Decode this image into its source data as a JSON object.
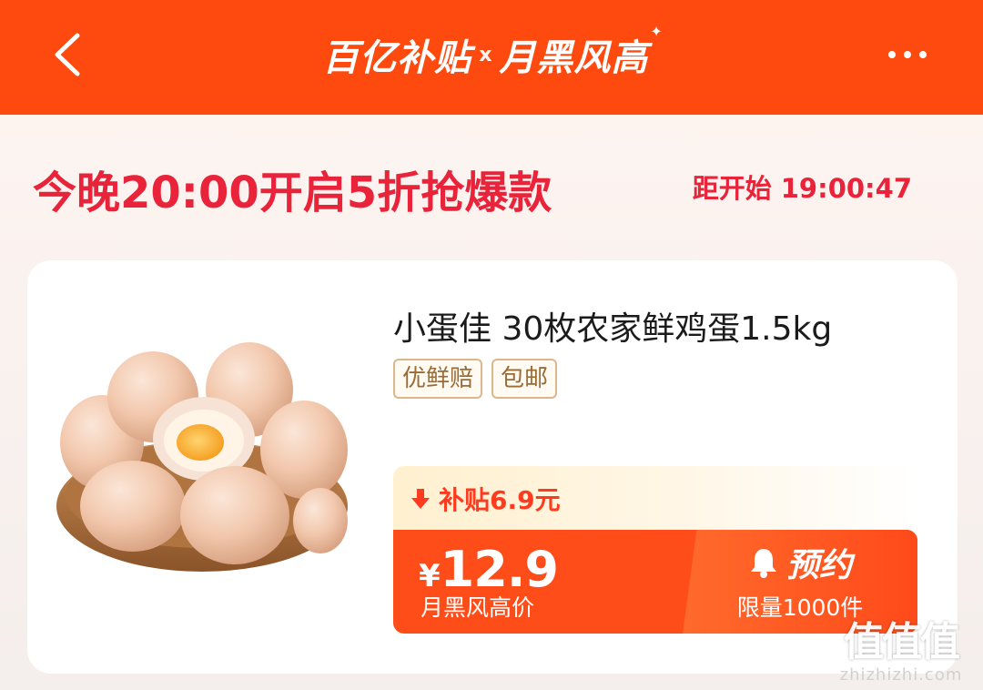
{
  "header": {
    "logo_left": "百亿补贴",
    "logo_separator": "x",
    "logo_right": "月黑风高",
    "logo_sparkle": "✦",
    "bg_color": "#ff4a0f"
  },
  "promo": {
    "title": "今晚20:00开启5折抢爆款",
    "countdown_label": "距开始",
    "countdown_time": "19:00:47",
    "accent_color": "#e8233a"
  },
  "product": {
    "name": "小蛋佳 30枚农家鲜鸡蛋1.5kg",
    "tags": [
      "优鲜赔",
      "包邮"
    ],
    "subsidy_label": "补贴6.9元",
    "currency": "¥",
    "price": "12.9",
    "price_label": "月黑风高价",
    "reserve_label": "预约",
    "limit_label": "限量1000件",
    "image_icon": "eggs-in-bowl-image"
  },
  "watermark": {
    "logo_text": "值值值",
    "url": "zhizhizhi.com"
  }
}
